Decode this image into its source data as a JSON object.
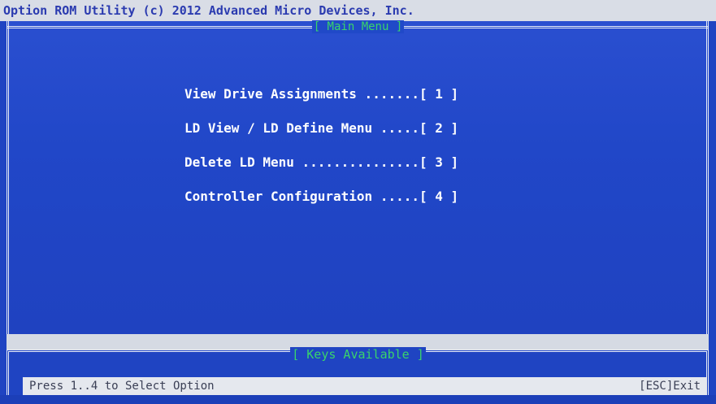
{
  "title_bar": {
    "text": "Option ROM Utility (c) 2012 Advanced Micro Devices, Inc."
  },
  "main_panel": {
    "title": "[ Main Menu ]",
    "items": [
      {
        "label": "View Drive Assignments .......[ 1 ]"
      },
      {
        "label": "LD View / LD Define Menu .....[ 2 ]"
      },
      {
        "label": "Delete LD Menu ...............[ 3 ]"
      },
      {
        "label": "Controller Configuration .....[ 4 ]"
      }
    ]
  },
  "keys_panel": {
    "title": "[ Keys Available ]",
    "hint": "Press 1..4 to Select Option",
    "exit": "[ESC]Exit"
  },
  "colors": {
    "background_blue": "#1f44c2",
    "accent_green": "#39d36b",
    "text_white": "#ffffff"
  }
}
